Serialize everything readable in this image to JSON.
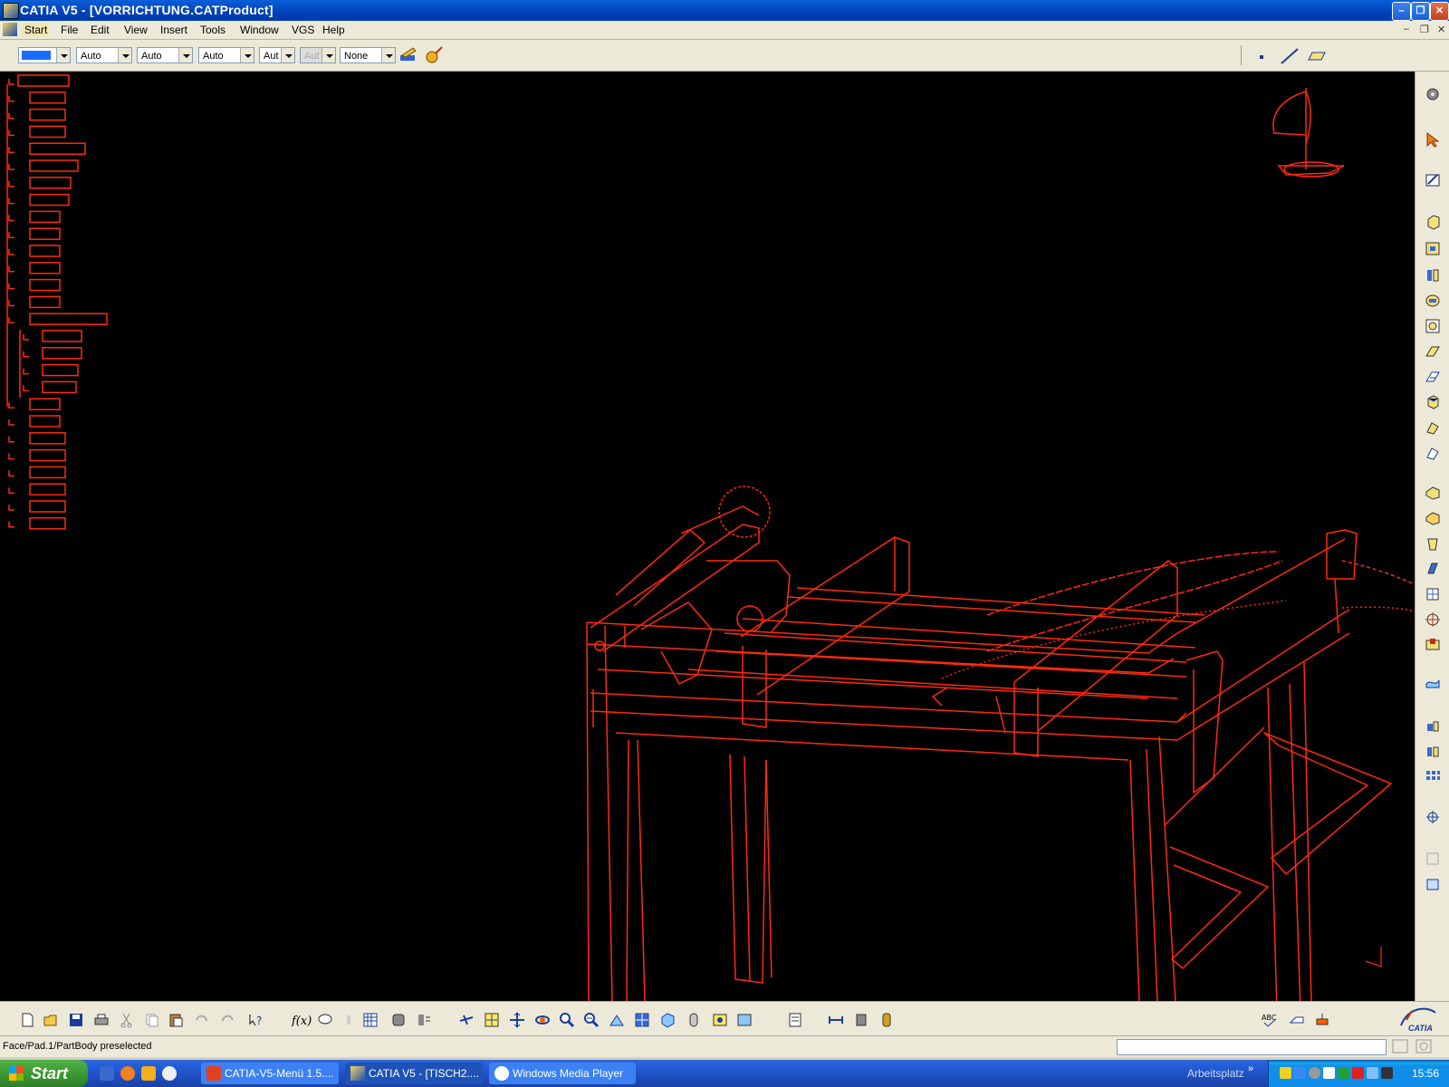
{
  "window": {
    "title": "CATIA V5 - [VORRICHTUNG.CATProduct]"
  },
  "menu": {
    "items": [
      "Start",
      "File",
      "Edit",
      "View",
      "Insert",
      "Tools",
      "Window",
      "VGS",
      "Help"
    ]
  },
  "toolbar": {
    "color_value": "",
    "color_swatch": "#1a6cff",
    "combo1": "Auto",
    "combo2": "Auto",
    "combo3": "Auto",
    "combo4": "Aut",
    "combo5": "Aut",
    "combo6": "None"
  },
  "viewport": {
    "background": "#000000",
    "wire_color": "#ff2a10"
  },
  "status": {
    "text": "Face/Pad.1/PartBody preselected"
  },
  "taskbar": {
    "start_label": "Start",
    "tasks": [
      "CATIA-V5-Menü 1.5....",
      "CATIA V5 - [TISCH2....",
      "Windows Media Player"
    ],
    "arbeitsplatz": "Arbeitsplatz",
    "clock": "15:56"
  },
  "brand": {
    "logo_text": "CATIA"
  }
}
